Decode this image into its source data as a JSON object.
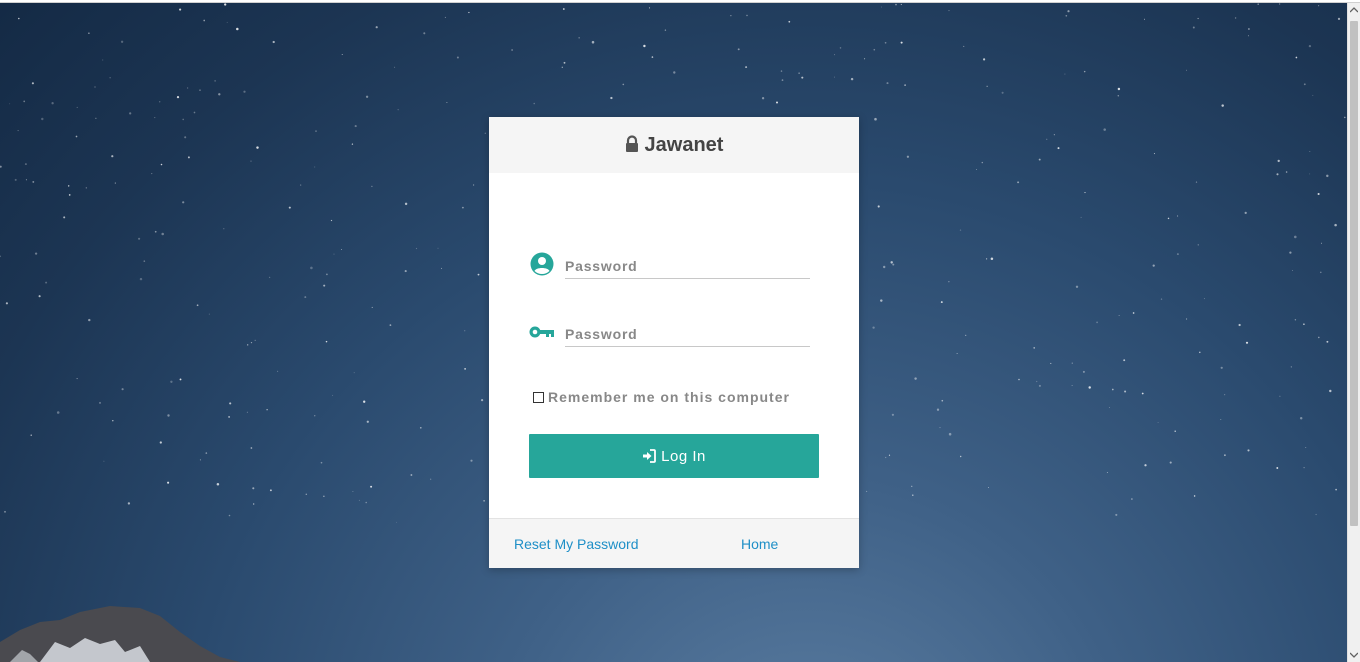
{
  "brand": {
    "title": "Jawanet",
    "lock_icon": "lock-icon"
  },
  "form": {
    "username": {
      "placeholder": "Password",
      "value": "",
      "icon": "user-circle-icon"
    },
    "password": {
      "placeholder": "Password",
      "value": "",
      "icon": "key-icon"
    },
    "remember_label": "Remember me on this computer",
    "remember_checked": false,
    "login_label": "Log In",
    "login_icon": "sign-in-icon"
  },
  "footer": {
    "reset_label": "Reset My Password",
    "home_label": "Home"
  },
  "colors": {
    "accent": "#26a69a",
    "link": "#1e8fc7",
    "header_bg": "#f5f5f5",
    "background_night": "#2a4a6e"
  }
}
